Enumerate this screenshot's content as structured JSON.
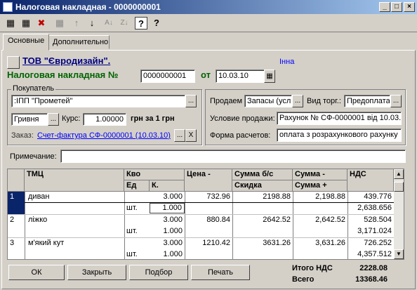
{
  "window": {
    "title": "Налоговая накладная - 0000000001",
    "min": "_",
    "max": "□",
    "close": "×"
  },
  "toolbar": {
    "b1": "▦",
    "b2": "▦",
    "b3": "✖",
    "b4": "▦",
    "up": "↑",
    "down": "↓",
    "sort_az": "A↓",
    "sort_za": "Z↓",
    "help": "?",
    "help2": "?"
  },
  "tabs": {
    "main": "Основные",
    "extra": "Дополнительно"
  },
  "header": {
    "org": "ТОВ \"Євродизайн\".",
    "user": "Інна",
    "doc_label": "Налоговая накладная №",
    "doc_number": "0000000001",
    "date_label": "от",
    "date": "10.03.10"
  },
  "buyer": {
    "group_label": "Покупатель",
    "name": ":ІПП \"Прометей\"",
    "currency": "Гривня",
    "rate_label": "Курс:",
    "rate": "1.00000",
    "rate_suffix": "грн за 1 грн",
    "order_label": "Заказ:",
    "order_link": "Счет-фактура СФ-0000001 (10.03.10)"
  },
  "sale": {
    "sell_label": "Продаем",
    "sell_value": "Запасы (усл",
    "trade_label": "Вид торг.:",
    "trade_value": "Предоплата",
    "cond_label": "Условие продажи:",
    "cond_value": "Рахунок № СФ-0000001 від 10.03.",
    "form_label": "Форма расчетов:",
    "form_value": "оплата з розрахункового рахунку"
  },
  "note": {
    "label": "Примечание:",
    "value": ""
  },
  "table": {
    "h_tmc": "ТМЦ",
    "h_qty": "Кво",
    "h_unit": "Ед",
    "h_k": "К.",
    "h_price": "Цена -",
    "h_sum_nv": "Сумма б/с",
    "h_discount": "Скидка",
    "h_sum": "Сумма -",
    "h_sum_plus": "Сумма +",
    "h_vat": "НДС",
    "rows": [
      {
        "n": "1",
        "name": "диван",
        "qty": "3.000",
        "unit": "шт.",
        "k": "1.000",
        "price": "732.96",
        "sum_nv": "2198.88",
        "sum": "2,198.88",
        "vat": "439.776",
        "sum_plus": "2,638.656"
      },
      {
        "n": "2",
        "name": "ліжко",
        "qty": "3.000",
        "unit": "шт.",
        "k": "1.000",
        "price": "880.84",
        "sum_nv": "2642.52",
        "sum": "2,642.52",
        "vat": "528.504",
        "sum_plus": "3,171.024"
      },
      {
        "n": "3",
        "name": "м'який кут",
        "qty": "3.000",
        "unit": "шт.",
        "k": "1.000",
        "price": "1210.42",
        "sum_nv": "3631.26",
        "sum": "3,631.26",
        "vat": "726.252",
        "sum_plus": "4,357.512"
      }
    ]
  },
  "buttons": {
    "ok": "ОК",
    "close": "Закрыть",
    "select": "Подбор",
    "print": "Печать",
    "dots": "...",
    "x": "X"
  },
  "totals": {
    "vat_label": "Итого НДС",
    "vat_value": "2228.08",
    "total_label": "Всего",
    "total_value": "13368.46"
  },
  "colors": {
    "org": "#000080",
    "doc_label": "#006400",
    "user": "#0000ff",
    "selected_row": "#0a246a"
  }
}
